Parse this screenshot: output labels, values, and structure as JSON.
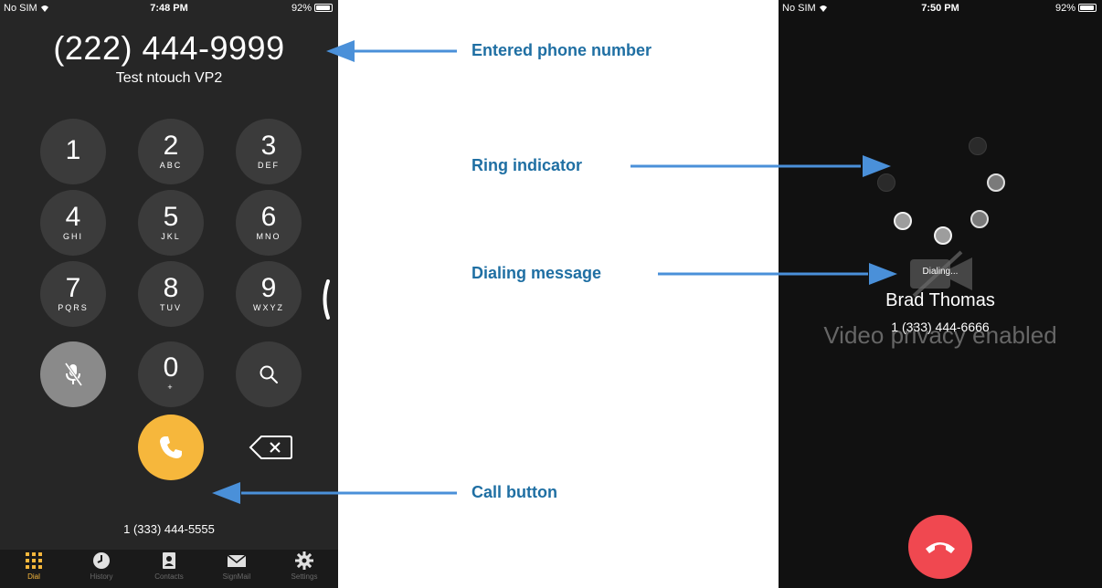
{
  "left_phone": {
    "status": {
      "carrier": "No SIM",
      "time": "7:48 PM",
      "battery": "92%"
    },
    "entered_number": "(222) 444-9999",
    "contact_name": "Test ntouch VP2",
    "keys": [
      {
        "digit": "1",
        "letters": ""
      },
      {
        "digit": "2",
        "letters": "ABC"
      },
      {
        "digit": "3",
        "letters": "DEF"
      },
      {
        "digit": "4",
        "letters": "GHI"
      },
      {
        "digit": "5",
        "letters": "JKL"
      },
      {
        "digit": "6",
        "letters": "MNO"
      },
      {
        "digit": "7",
        "letters": "PQRS"
      },
      {
        "digit": "8",
        "letters": "TUV"
      },
      {
        "digit": "9",
        "letters": "WXYZ"
      },
      {
        "digit": "0",
        "letters": "+"
      }
    ],
    "my_number": "1 (333) 444-5555",
    "tabs": [
      "Dial",
      "History",
      "Contacts",
      "SignMail",
      "Settings"
    ],
    "accent_color": "#f6b73c"
  },
  "right_phone": {
    "status": {
      "carrier": "No SIM",
      "time": "7:50 PM",
      "battery": "92%"
    },
    "dialing_text": "Dialing...",
    "callee_name": "Brad Thomas",
    "callee_number": "1 (333) 444-6666",
    "privacy_text": "Video privacy enabled",
    "end_color": "#f04850"
  },
  "annotations": {
    "entered": "Entered phone number",
    "ring": "Ring indicator",
    "dialing": "Dialing message",
    "call": "Call button",
    "color": "#1f6fa3"
  }
}
